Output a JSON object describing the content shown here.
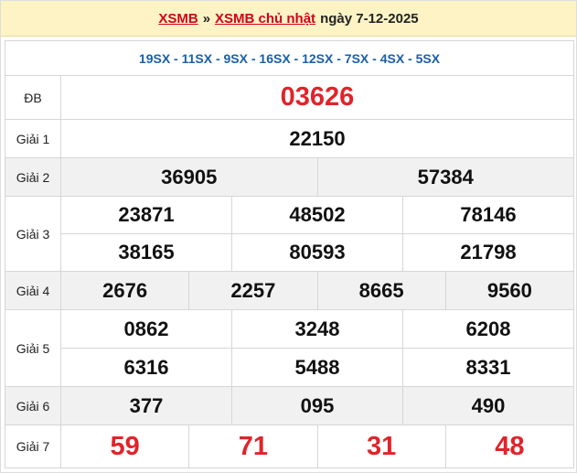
{
  "header": {
    "link1": "XSMB",
    "separator": "»",
    "link2": "XSMB chủ nhật",
    "date_text": "ngày 7-12-2025"
  },
  "codes": "19SX - 11SX - 9SX - 16SX - 12SX - 7SX - 4SX - 5SX",
  "prizes": {
    "db": {
      "label": "ĐB",
      "numbers": [
        "03626"
      ]
    },
    "g1": {
      "label": "Giải 1",
      "numbers": [
        "22150"
      ]
    },
    "g2": {
      "label": "Giải 2",
      "numbers": [
        "36905",
        "57384"
      ]
    },
    "g3": {
      "label": "Giải 3",
      "numbers": [
        "23871",
        "48502",
        "78146",
        "38165",
        "80593",
        "21798"
      ]
    },
    "g4": {
      "label": "Giải 4",
      "numbers": [
        "2676",
        "2257",
        "8665",
        "9560"
      ]
    },
    "g5": {
      "label": "Giải 5",
      "numbers": [
        "0862",
        "3248",
        "6208",
        "6316",
        "5488",
        "8331"
      ]
    },
    "g6": {
      "label": "Giải 6",
      "numbers": [
        "377",
        "095",
        "490"
      ]
    },
    "g7": {
      "label": "Giải 7",
      "numbers": [
        "59",
        "71",
        "31",
        "48"
      ]
    }
  },
  "colors": {
    "header_bg": "#fdf3c4",
    "accent_red": "#e0242a",
    "code_blue": "#1a5fa8",
    "row_grey": "#f1f1f1"
  }
}
